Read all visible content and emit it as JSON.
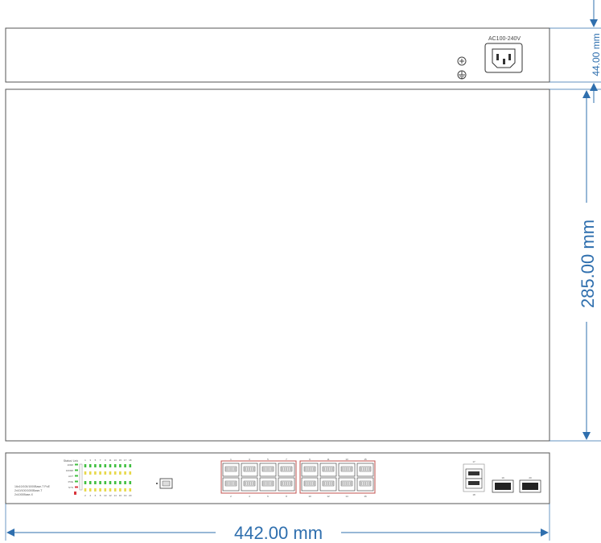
{
  "power_label": "AC100-240V",
  "dimensions": {
    "height": "44.00 mm",
    "depth": "285.00 mm",
    "width": "442.00 mm"
  },
  "front_panel": {
    "status_title": "Status/ Link",
    "led_rows": [
      "100M",
      "1000M",
      "ACT",
      "POE",
      "SYS"
    ],
    "top_port_numbers": [
      "1",
      "3",
      "5",
      "7",
      "9",
      "11",
      "13",
      "15",
      "17",
      "18"
    ],
    "bottom_port_numbers": [
      "2",
      "4",
      "6",
      "8",
      "10",
      "12",
      "14",
      "16",
      "19",
      "20"
    ],
    "spec_lines": [
      "16x10/100/1000Base-T PoE",
      "2x10/100/1000Base-T",
      "2x1000Base-X"
    ],
    "rj45_top_labels": [
      "1",
      "3",
      "5",
      "7",
      "9",
      "11",
      "13",
      "15"
    ],
    "rj45_bottom_labels": [
      "2",
      "4",
      "6",
      "8",
      "10",
      "12",
      "14",
      "16"
    ],
    "uplink_labels": [
      "17",
      "18"
    ],
    "sfp_labels": [
      "19",
      "20"
    ]
  },
  "colors": {
    "dimension": "#2f6fae",
    "outline": "#555555",
    "port_block": "#c0504d",
    "led_green": "#3fbf3f",
    "led_yellow": "#e8d84a",
    "led_red": "#d9363e"
  }
}
